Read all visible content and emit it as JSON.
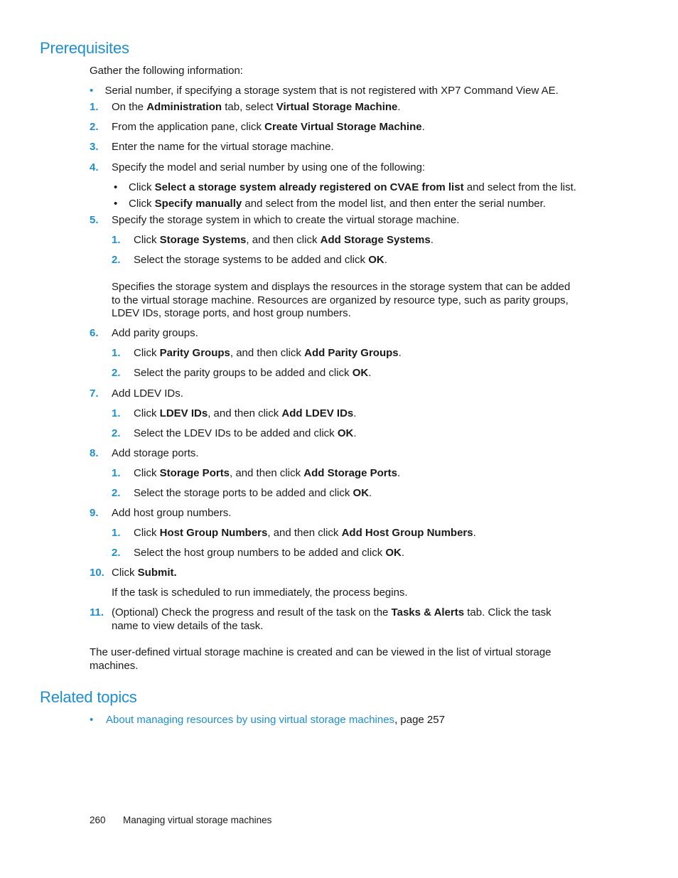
{
  "prereq": {
    "heading": "Prerequisites",
    "intro": "Gather the following information:",
    "bullet": "Serial number, if specifying a storage system that is not registered with XP7 Command View AE."
  },
  "steps": {
    "s1": {
      "num": "1.",
      "a": "On the ",
      "b1": "Administration",
      "c": " tab, select ",
      "b2": "Virtual Storage Machine",
      "d": "."
    },
    "s2": {
      "num": "2.",
      "a": "From the application pane, click ",
      "b1": "Create Virtual Storage Machine",
      "c": "."
    },
    "s3": {
      "num": "3.",
      "a": "Enter the name for the virtual storage machine."
    },
    "s4": {
      "num": "4.",
      "a": "Specify the model and serial number by using one of the following:",
      "opt1": {
        "a": "Click ",
        "b": "Select a storage system already registered on CVAE from list",
        "c": " and select from the list."
      },
      "opt2": {
        "a": "Click ",
        "b": "Specify manually",
        "c": " and select from the model list, and then enter the serial number."
      }
    },
    "s5": {
      "num": "5.",
      "a": "Specify the storage system in which to create the virtual storage machine.",
      "sub1": {
        "num": "1.",
        "a": "Click ",
        "b1": "Storage Systems",
        "c": ", and then click ",
        "b2": "Add Storage Systems",
        "d": "."
      },
      "sub2": {
        "num": "2.",
        "a": "Select the storage systems to be added and click ",
        "b": "OK",
        "c": "."
      },
      "note1": "Specifies the storage system and displays the resources in the storage system that can be added",
      "note2": "to the virtual storage machine. Resources are organized by resource type, such as parity groups,",
      "note3": "LDEV IDs, storage ports, and host group numbers."
    },
    "s6": {
      "num": "6.",
      "a": "Add parity groups.",
      "sub1": {
        "num": "1.",
        "a": "Click ",
        "b1": "Parity Groups",
        "c": ", and then click ",
        "b2": "Add Parity Groups",
        "d": "."
      },
      "sub2": {
        "num": "2.",
        "a": "Select the parity groups to be added and click ",
        "b": "OK",
        "c": "."
      }
    },
    "s7": {
      "num": "7.",
      "a": "Add LDEV IDs.",
      "sub1": {
        "num": "1.",
        "a": "Click ",
        "b1": "LDEV IDs",
        "c": ", and then click ",
        "b2": "Add LDEV IDs",
        "d": "."
      },
      "sub2": {
        "num": "2.",
        "a": "Select the LDEV IDs to be added and click ",
        "b": "OK",
        "c": "."
      }
    },
    "s8": {
      "num": "8.",
      "a": "Add storage ports.",
      "sub1": {
        "num": "1.",
        "a": "Click ",
        "b1": "Storage Ports",
        "c": ", and then click ",
        "b2": "Add Storage Ports",
        "d": "."
      },
      "sub2": {
        "num": "2.",
        "a": "Select the storage ports to be added and click ",
        "b": "OK",
        "c": "."
      }
    },
    "s9": {
      "num": "9.",
      "a": "Add host group numbers.",
      "sub1": {
        "num": "1.",
        "a": "Click ",
        "b1": "Host Group Numbers",
        "c": ", and then click ",
        "b2": "Add Host Group Numbers",
        "d": "."
      },
      "sub2": {
        "num": "2.",
        "a": "Select the host group numbers to be added and click ",
        "b": "OK",
        "c": "."
      }
    },
    "s10": {
      "num": "10.",
      "a": "Click ",
      "b": "Submit.",
      "note": "If the task is scheduled to run immediately, the process begins."
    },
    "s11": {
      "num": "11.",
      "a": "(Optional) Check the progress and result of the task on the ",
      "b": "Tasks & Alerts",
      "c": " tab. Click the task",
      "line2": "name to view details of the task."
    }
  },
  "result1": "The user-defined virtual storage machine is created and can be viewed in the list of virtual storage",
  "result2": "machines.",
  "related": {
    "heading": "Related topics",
    "link": "About managing resources by using virtual storage machines",
    "suffix": ", page 257"
  },
  "footer": {
    "page": "260",
    "title": "Managing virtual storage machines"
  }
}
